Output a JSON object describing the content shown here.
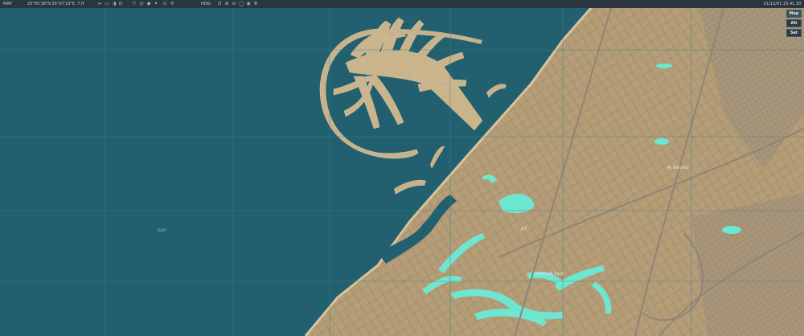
{
  "topbar": {
    "section_label": "MAP",
    "coordinates": "25°05'16\"N 55°07'23\"E, 7 ft",
    "heading_label": "HDG:",
    "time": "01/12/01 25.41.20"
  },
  "toolbar_icons": [
    "move-icon",
    "zoom-in-icon",
    "zoom-out-icon",
    "measure-icon",
    "filter-icon",
    "target-icon",
    "layers-icon",
    "marker-icon",
    "search-icon",
    "zoom-fit-icon",
    "zoom-plus-icon",
    "locate-icon",
    "settings-icon"
  ],
  "layers": {
    "items": [
      {
        "label": "Map"
      },
      {
        "label": "Alt"
      },
      {
        "label": "Sat"
      }
    ]
  },
  "map_labels": {
    "sea": "Gulf",
    "district_1": "Al Barsha",
    "district_2": "JLT",
    "district_3": "Jumeirah Park"
  },
  "colors": {
    "sea": "#23606f",
    "land": "#b59e78",
    "water_features": "#6ee6d1",
    "grid": "#3f7f8e"
  }
}
